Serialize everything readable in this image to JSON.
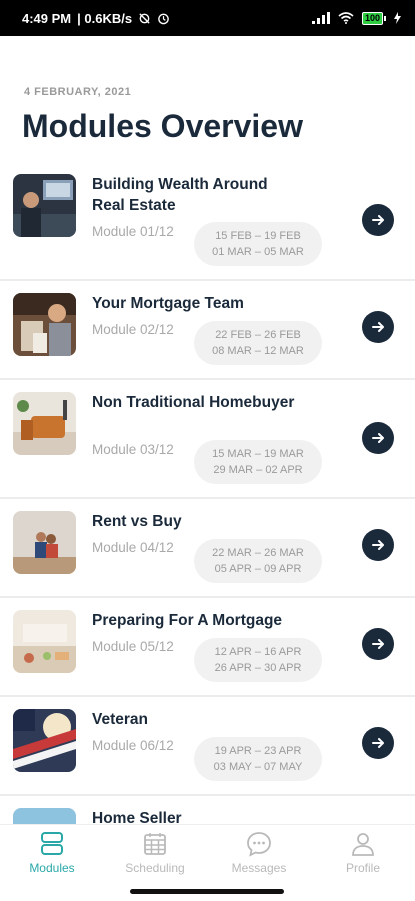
{
  "status_bar": {
    "time": "4:49 PM",
    "speed": "| 0.6KB/s",
    "battery": "100"
  },
  "header": {
    "date": "4  FEBRUARY, 2021",
    "title": "Modules Overview"
  },
  "modules": [
    {
      "title": "Building Wealth Around Real Estate",
      "module": "Module 01/12",
      "dates": [
        "15 FEB – 19 FEB",
        "01 MAR – 05 MAR"
      ]
    },
    {
      "title": "Your Mortgage Team",
      "module": "Module 02/12",
      "dates": [
        "22 FEB – 26 FEB",
        "08 MAR – 12 MAR"
      ]
    },
    {
      "title": "Non Traditional Homebuyer",
      "module": "Module 03/12",
      "dates": [
        "15 MAR – 19 MAR",
        "29 MAR – 02 APR"
      ]
    },
    {
      "title": "Rent vs Buy",
      "module": "Module 04/12",
      "dates": [
        "22 MAR – 26 MAR",
        "05 APR – 09 APR"
      ]
    },
    {
      "title": "Preparing For A Mortgage",
      "module": "Module 05/12",
      "dates": [
        "12 APR – 16 APR",
        "26 APR – 30 APR"
      ]
    },
    {
      "title": "Veteran",
      "module": "Module 06/12",
      "dates": [
        "19 APR – 23 APR",
        "03 MAY – 07 MAY"
      ]
    },
    {
      "title": "Home Seller",
      "module": "",
      "dates": [
        "",
        ""
      ]
    }
  ],
  "tabs": [
    {
      "label": "Modules",
      "icon": "modules-icon",
      "active": true
    },
    {
      "label": "Scheduling",
      "icon": "calendar-icon",
      "active": false
    },
    {
      "label": "Messages",
      "icon": "chat-bubble-icon",
      "active": false
    },
    {
      "label": "Profile",
      "icon": "person-icon",
      "active": false
    }
  ],
  "colors": {
    "primary_dark": "#1b2a3b",
    "active_tab": "#2aa8a8",
    "muted_text": "#a9a9a9",
    "date_pill_bg": "#f1f1f1"
  }
}
